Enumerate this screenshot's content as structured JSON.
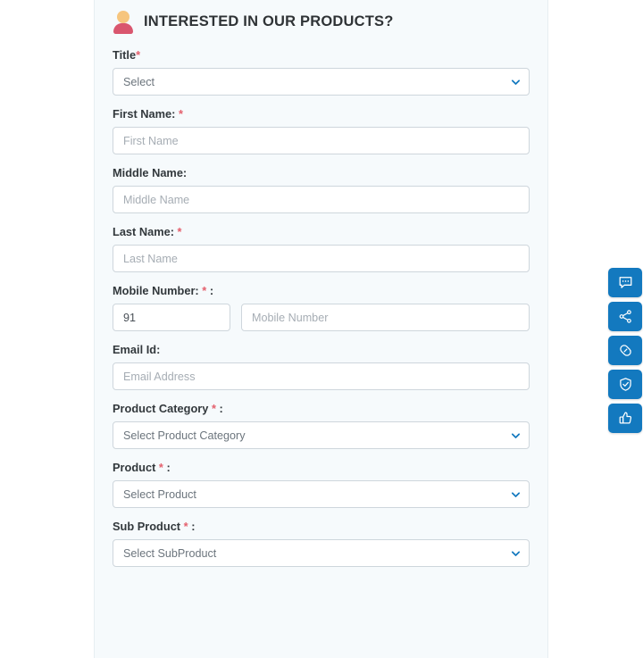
{
  "panel": {
    "header": {
      "icon": "user-icon",
      "title": "INTERESTED IN OUR PRODUCTS?"
    },
    "fields": [
      {
        "key": "title",
        "label": "Title",
        "required_mark": "*",
        "suffix": "",
        "type": "select",
        "value": "Select",
        "chevron": "chevron-down-icon"
      },
      {
        "key": "first_name",
        "label": "First Name:",
        "required_mark": "*",
        "suffix": "",
        "type": "text",
        "value": "",
        "placeholder": "First Name"
      },
      {
        "key": "middle_name",
        "label": "Middle Name:",
        "required_mark": "",
        "suffix": "",
        "type": "text",
        "value": "",
        "placeholder": "Middle Name"
      },
      {
        "key": "last_name",
        "label": "Last Name:",
        "required_mark": "*",
        "suffix": "",
        "type": "text",
        "value": "",
        "placeholder": "Last Name"
      },
      {
        "key": "mobile_number",
        "label": "Mobile Number:",
        "required_mark": "*",
        "suffix": ":",
        "type": "phone",
        "country_code_value": "91",
        "country_code_placeholder": "",
        "number_value": "",
        "number_placeholder": "Mobile Number"
      },
      {
        "key": "email_id",
        "label": "Email Id:",
        "required_mark": "",
        "suffix": "",
        "type": "text",
        "value": "",
        "placeholder": "Email Address"
      },
      {
        "key": "product_category",
        "label": "Product Category",
        "required_mark": "*",
        "suffix": ":",
        "type": "select",
        "value": "Select Product Category",
        "chevron": "chevron-down-icon"
      },
      {
        "key": "product",
        "label": "Product",
        "required_mark": "*",
        "suffix": ":",
        "type": "select",
        "value": "Select Product",
        "chevron": "chevron-down-icon"
      },
      {
        "key": "sub_product",
        "label": "Sub Product",
        "required_mark": "*",
        "suffix": ":",
        "type": "select",
        "value": "Select SubProduct",
        "chevron": "chevron-down-icon"
      }
    ]
  },
  "rail": {
    "buttons": [
      {
        "name": "chat-icon",
        "label": "Chat"
      },
      {
        "name": "share-icon",
        "label": "Share"
      },
      {
        "name": "link-icon",
        "label": "Link"
      },
      {
        "name": "shield-check-icon",
        "label": "Verified"
      },
      {
        "name": "thumbs-up-icon",
        "label": "Like"
      }
    ]
  },
  "colors": {
    "accent_blue": "#1379bf",
    "panel_bg": "#f6fafc",
    "page_bg": "#ffffff",
    "required_red": "#e4606d",
    "icon_head": "#f6c57e",
    "icon_body": "#d9566e",
    "border": "#ced6dc",
    "label_text": "#32383c",
    "placeholder_text": "#a6adb4"
  }
}
